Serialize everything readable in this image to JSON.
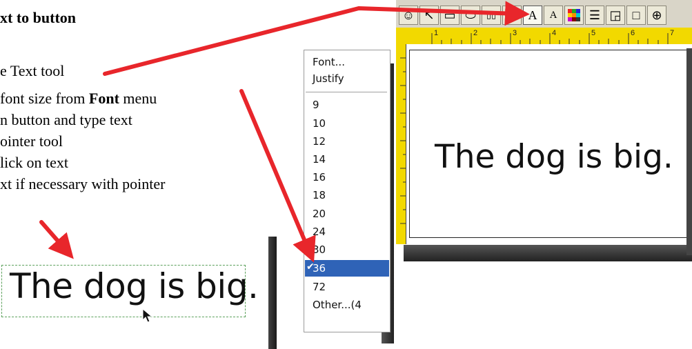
{
  "instructions": {
    "title": "xt to button",
    "steps": [
      "e Text tool",
      "font size from",
      "Font",
      "menu",
      "n button and type text",
      "ointer tool",
      "lick on text",
      "xt if necessary with pointer"
    ]
  },
  "example": {
    "text": "The dog is big."
  },
  "font_menu": {
    "items_top": [
      "Font...",
      "Justify"
    ],
    "sizes": [
      "9",
      "10",
      "12",
      "14",
      "16",
      "18",
      "20",
      "24",
      "30",
      "36",
      "72"
    ],
    "selected": "36",
    "other": "Other...(4"
  },
  "toolbar": {
    "buttons": [
      {
        "icon": "face-icon",
        "glyph": "☺"
      },
      {
        "icon": "pointer-icon",
        "glyph": "↖"
      },
      {
        "icon": "rect-icon",
        "glyph": "▭"
      },
      {
        "icon": "shape-icon",
        "glyph": "⬭"
      },
      {
        "icon": "grid-icon",
        "glyph": "▯▯"
      },
      {
        "icon": "text-icon",
        "glyph": "A"
      },
      {
        "icon": "text-symbol-icon",
        "glyph": "A☺"
      },
      {
        "icon": "color-palette-icon",
        "glyph": "▦"
      },
      {
        "icon": "line-width-icon",
        "glyph": "☰"
      },
      {
        "icon": "corner-icon",
        "glyph": "◲"
      },
      {
        "icon": "frame-icon",
        "glyph": "□"
      },
      {
        "icon": "zoom-icon",
        "glyph": "⊕"
      }
    ],
    "ruler_numbers": [
      "1",
      "2",
      "3",
      "4",
      "5",
      "6",
      "7"
    ]
  },
  "card": {
    "text": "The dog is big."
  },
  "colors": {
    "arrow": "#e8262b",
    "ruler": "#f2d900",
    "menu_selected": "#2f63b7"
  }
}
